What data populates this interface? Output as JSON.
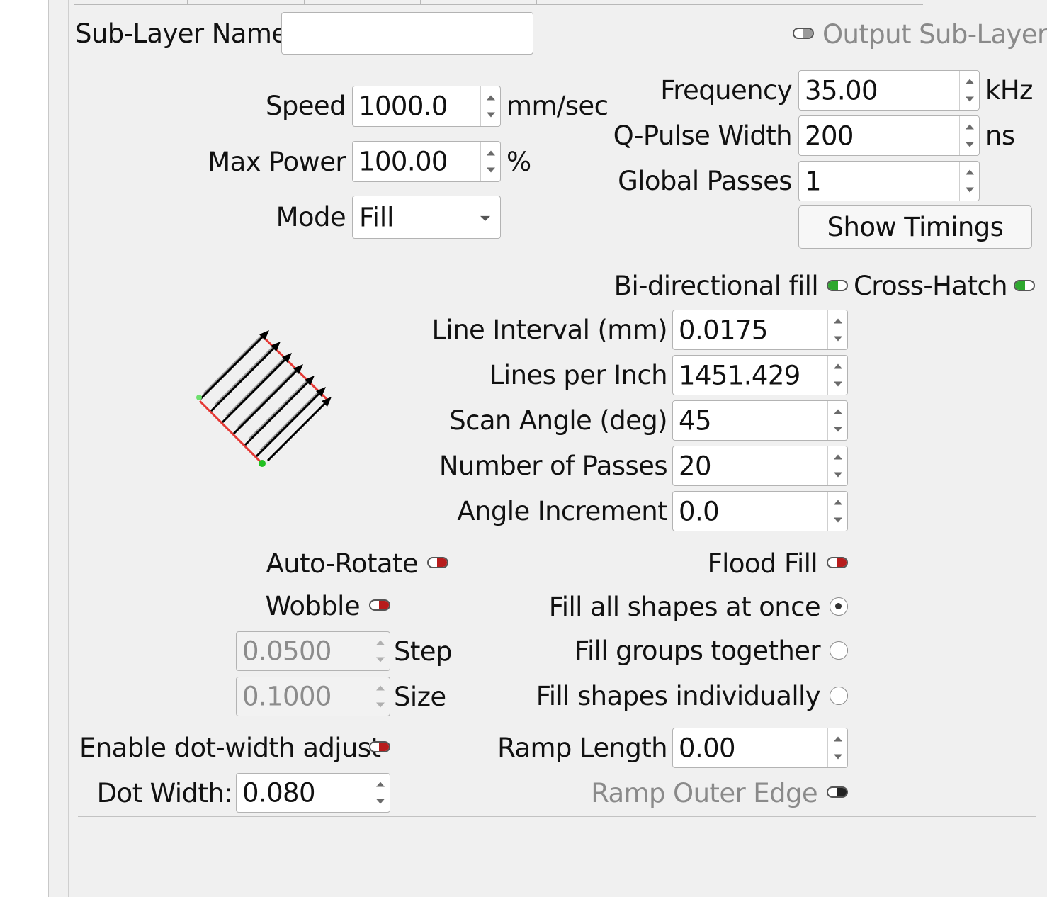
{
  "sublayer": {
    "name_label": "Sub-Layer Name",
    "name_value": "",
    "output_label": "Output Sub-Layer"
  },
  "speed": {
    "label": "Speed",
    "value": "1000.0",
    "unit": "mm/sec"
  },
  "max_power": {
    "label": "Max Power",
    "value": "100.00",
    "unit": "%"
  },
  "mode": {
    "label": "Mode",
    "value": "Fill"
  },
  "frequency": {
    "label": "Frequency",
    "value": "35.00",
    "unit": "kHz"
  },
  "q_pulse": {
    "label": "Q-Pulse Width",
    "value": "200",
    "unit": "ns"
  },
  "global_passes": {
    "label": "Global Passes",
    "value": "1"
  },
  "show_timings_label": "Show Timings",
  "fill": {
    "bidir_label": "Bi-directional fill",
    "crosshatch_label": "Cross-Hatch",
    "line_interval": {
      "label": "Line Interval (mm)",
      "value": "0.0175"
    },
    "lines_per_inch": {
      "label": "Lines per Inch",
      "value": "1451.429"
    },
    "scan_angle": {
      "label": "Scan Angle (deg)",
      "value": "45"
    },
    "num_passes": {
      "label": "Number of Passes",
      "value": "20"
    },
    "angle_increment": {
      "label": "Angle Increment",
      "value": "0.0"
    }
  },
  "options": {
    "auto_rotate_label": "Auto-Rotate",
    "wobble_label": "Wobble",
    "step": {
      "label": "Step",
      "value": "0.0500"
    },
    "size": {
      "label": "Size",
      "value": "0.1000"
    },
    "flood_fill_label": "Flood Fill",
    "fill_all_label": "Fill all shapes at once",
    "fill_groups_label": "Fill groups together",
    "fill_individually_label": "Fill shapes individually"
  },
  "dot": {
    "enable_label": "Enable dot-width adjust",
    "width_label": "Dot Width:",
    "width_value": "0.080",
    "ramp_length_label": "Ramp Length",
    "ramp_length_value": "0.00",
    "ramp_outer_label": "Ramp Outer Edge"
  },
  "colors": {
    "toggle_on": "#2ea82e",
    "toggle_off": "#b71c1c",
    "preview_edge": "#e53935",
    "preview_start": "#22c022"
  }
}
